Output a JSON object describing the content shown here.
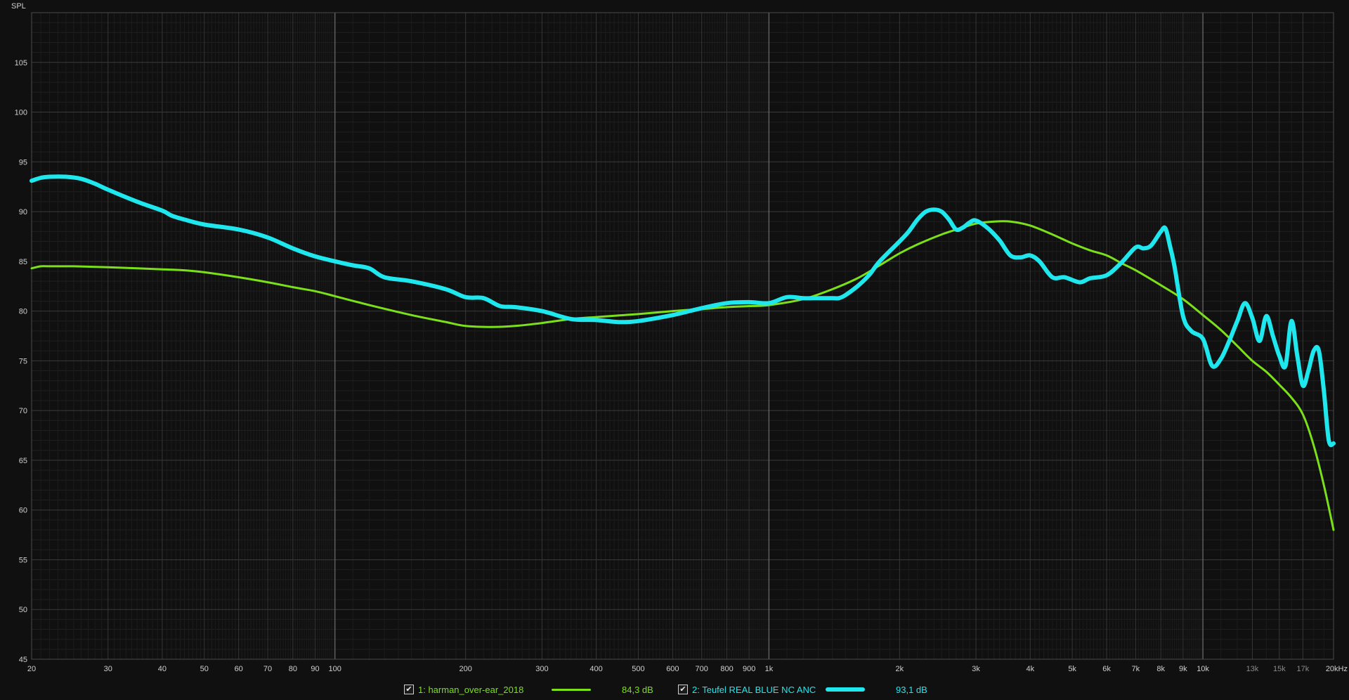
{
  "chart_data": {
    "type": "line",
    "title": "",
    "ylabel": "SPL",
    "xlabel": "",
    "x_scale": "log",
    "xlim": [
      20,
      20000
    ],
    "ylim": [
      45,
      110
    ],
    "grid": true,
    "legend_position": "bottom-center",
    "y_ticks": [
      45,
      50,
      55,
      60,
      65,
      70,
      75,
      80,
      85,
      90,
      95,
      100,
      105
    ],
    "x_ticks": [
      {
        "v": 20,
        "label": "20"
      },
      {
        "v": 30,
        "label": "30"
      },
      {
        "v": 40,
        "label": "40"
      },
      {
        "v": 50,
        "label": "50"
      },
      {
        "v": 60,
        "label": "60"
      },
      {
        "v": 70,
        "label": "70"
      },
      {
        "v": 80,
        "label": "80"
      },
      {
        "v": 90,
        "label": "90"
      },
      {
        "v": 100,
        "label": "100"
      },
      {
        "v": 200,
        "label": "200"
      },
      {
        "v": 300,
        "label": "300"
      },
      {
        "v": 400,
        "label": "400"
      },
      {
        "v": 500,
        "label": "500"
      },
      {
        "v": 600,
        "label": "600"
      },
      {
        "v": 700,
        "label": "700"
      },
      {
        "v": 800,
        "label": "800"
      },
      {
        "v": 900,
        "label": "900"
      },
      {
        "v": 1000,
        "label": "1k"
      },
      {
        "v": 2000,
        "label": "2k"
      },
      {
        "v": 3000,
        "label": "3k"
      },
      {
        "v": 4000,
        "label": "4k"
      },
      {
        "v": 5000,
        "label": "5k"
      },
      {
        "v": 6000,
        "label": "6k"
      },
      {
        "v": 7000,
        "label": "7k"
      },
      {
        "v": 8000,
        "label": "8k"
      },
      {
        "v": 9000,
        "label": "9k"
      },
      {
        "v": 10000,
        "label": "10k"
      },
      {
        "v": 13000,
        "label": "13k"
      },
      {
        "v": 15000,
        "label": "15k"
      },
      {
        "v": 17000,
        "label": "17k"
      },
      {
        "v": 20000,
        "label": "20kHz"
      }
    ],
    "series": [
      {
        "name": "1: harman_over-ear_2018",
        "level": "84,3 dB",
        "color": "#7be01a",
        "width": 3,
        "x": [
          20,
          21,
          22,
          25,
          30,
          35,
          40,
          45,
          50,
          60,
          70,
          80,
          90,
          100,
          120,
          150,
          180,
          200,
          230,
          260,
          300,
          350,
          400,
          500,
          600,
          700,
          800,
          900,
          1000,
          1200,
          1400,
          1600,
          1800,
          2000,
          2200,
          2500,
          2800,
          3000,
          3300,
          3600,
          4000,
          4500,
          5000,
          5500,
          6000,
          6500,
          7000,
          8000,
          9000,
          10000,
          11000,
          12000,
          13000,
          14000,
          15000,
          16000,
          17000,
          18000,
          19000,
          20000
        ],
        "y": [
          84.3,
          84.5,
          84.5,
          84.5,
          84.4,
          84.3,
          84.2,
          84.1,
          83.9,
          83.4,
          82.9,
          82.4,
          82.0,
          81.5,
          80.6,
          79.6,
          78.9,
          78.5,
          78.4,
          78.5,
          78.8,
          79.2,
          79.4,
          79.7,
          80.0,
          80.2,
          80.4,
          80.5,
          80.6,
          81.2,
          82.2,
          83.3,
          84.6,
          85.8,
          86.7,
          87.7,
          88.4,
          88.8,
          89.0,
          89.0,
          88.6,
          87.7,
          86.8,
          86.1,
          85.6,
          84.8,
          84.1,
          82.6,
          81.2,
          79.6,
          78.1,
          76.5,
          75.0,
          73.9,
          72.6,
          71.3,
          69.6,
          66.5,
          62.5,
          58.0
        ]
      },
      {
        "name": "2: Teufel REAL BLUE NC ANC",
        "level": "93,1 dB",
        "color": "#1ee8ee",
        "width": 6,
        "x": [
          20,
          21,
          22,
          24,
          26,
          28,
          30,
          35,
          40,
          42,
          45,
          50,
          60,
          70,
          80,
          90,
          100,
          110,
          120,
          130,
          150,
          180,
          200,
          220,
          240,
          260,
          300,
          350,
          400,
          450,
          500,
          600,
          700,
          800,
          900,
          1000,
          1100,
          1200,
          1300,
          1400,
          1450,
          1500,
          1600,
          1700,
          1800,
          2000,
          2100,
          2200,
          2300,
          2400,
          2500,
          2600,
          2700,
          2800,
          2900,
          3000,
          3200,
          3400,
          3600,
          3800,
          4000,
          4200,
          4500,
          4800,
          5200,
          5500,
          6000,
          6500,
          7000,
          7300,
          7600,
          8000,
          8200,
          8400,
          8600,
          9000,
          9400,
          10000,
          10500,
          11000,
          11500,
          12000,
          12500,
          13000,
          13500,
          14000,
          14500,
          15000,
          15500,
          16000,
          16500,
          17000,
          17500,
          18000,
          18500,
          19000,
          19500,
          20000
        ],
        "y": [
          93.1,
          93.4,
          93.5,
          93.5,
          93.3,
          92.8,
          92.2,
          91.0,
          90.1,
          89.6,
          89.2,
          88.7,
          88.2,
          87.4,
          86.3,
          85.5,
          85.0,
          84.6,
          84.3,
          83.4,
          83.0,
          82.2,
          81.4,
          81.3,
          80.5,
          80.4,
          80.0,
          79.2,
          79.1,
          78.9,
          79.0,
          79.6,
          80.3,
          80.8,
          80.9,
          80.8,
          81.4,
          81.3,
          81.3,
          81.3,
          81.3,
          81.6,
          82.5,
          83.6,
          85.0,
          87.0,
          88.0,
          89.2,
          90.0,
          90.2,
          90.0,
          89.2,
          88.2,
          88.4,
          88.9,
          89.1,
          88.3,
          87.1,
          85.6,
          85.4,
          85.6,
          85.0,
          83.4,
          83.4,
          82.9,
          83.3,
          83.6,
          84.9,
          86.4,
          86.3,
          86.6,
          88.0,
          88.3,
          86.5,
          84.5,
          79.5,
          78.0,
          77.2,
          74.5,
          75.2,
          77.0,
          79.0,
          80.8,
          79.3,
          77.0,
          79.5,
          77.5,
          75.5,
          74.5,
          79.0,
          75.5,
          72.5,
          74.0,
          76.0,
          76.0,
          72.0,
          67.0,
          66.7
        ]
      }
    ]
  }
}
